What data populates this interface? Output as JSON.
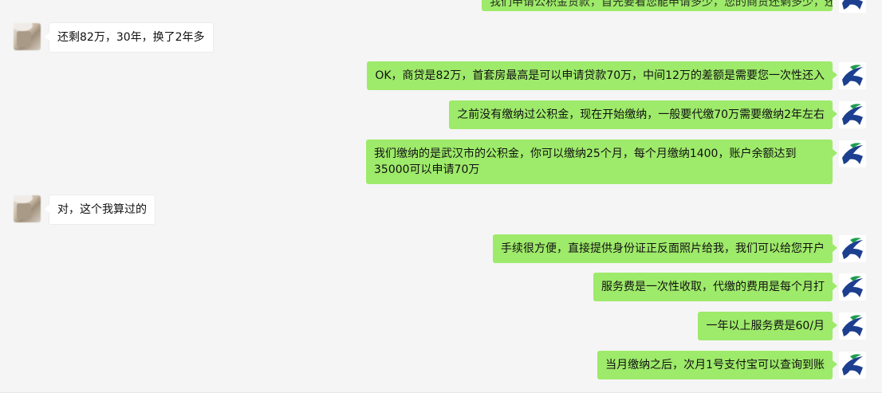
{
  "window": {
    "title": "WeChat chat"
  },
  "messages": [
    {
      "side": "right",
      "text": "我们申请公积金贷款，首先要看您能申请多少，您的商贷还剩多少，还多少年，还了多少年"
    },
    {
      "side": "left",
      "text": "还剩82万，30年，换了2年多"
    },
    {
      "side": "right",
      "text": "OK，商贷是82万，首套房最高是可以申请贷款70万，中间12万的差额是需要您一次性还入"
    },
    {
      "side": "right",
      "text": "之前没有缴纳过公积金，现在开始缴纳，一般要代缴70万需要缴纳2年左右"
    },
    {
      "side": "right",
      "text": "我们缴纳的是武汉市的公积金，你可以缴纳25个月，每个月缴纳1400，账户余额达到35000可以申请70万"
    },
    {
      "side": "left",
      "text": "对，这个我算过的"
    },
    {
      "side": "right",
      "text": "手续很方便，直接提供身份证正反面照片给我，我们可以给您开户"
    },
    {
      "side": "right",
      "text": "服务费是一次性收取，代缴的费用是每个月打"
    },
    {
      "side": "right",
      "text": "一年以上服务费是60/月"
    },
    {
      "side": "right",
      "text": "当月缴纳之后，次月1号支付宝可以查询到账"
    }
  ],
  "icons": {
    "customer_avatar": "blurred-user-avatar",
    "agent_avatar": "bird-logo-avatar"
  },
  "colors": {
    "background": "#f5f5f5",
    "outgoing_bubble": "#9eea6a",
    "incoming_bubble": "#ffffff",
    "logo_blue": "#1d3f8f",
    "logo_green": "#1c9d4e"
  }
}
